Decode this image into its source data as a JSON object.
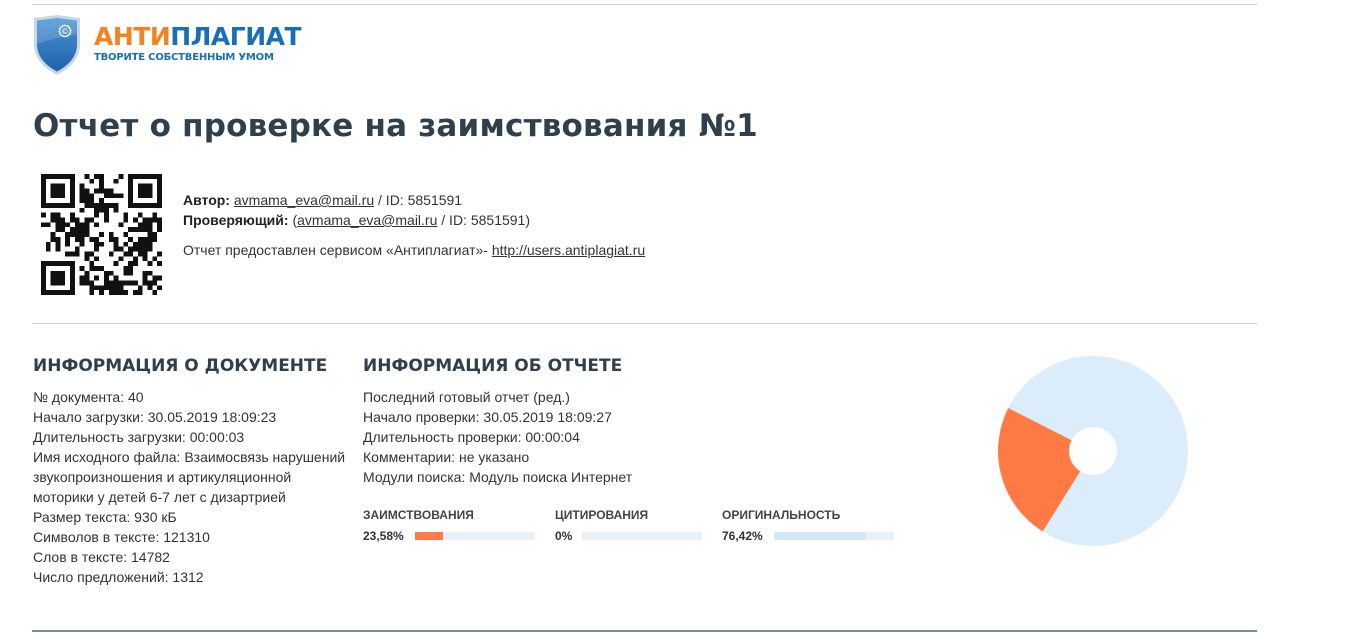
{
  "logo": {
    "name_part1": "АНТИ",
    "name_part2": "ПЛАГИАТ",
    "slogan": "ТВОРИТЕ СОБСТВЕННЫМ УМОМ",
    "shield_mark": "©"
  },
  "title": "Отчет о проверке на заимствования №1",
  "meta": {
    "author_label": "Автор:",
    "author_email": "avmama_eva@mail.ru",
    "author_id": " / ID: 5851591",
    "checker_label": "Проверяющий:",
    "checker_open": " (",
    "checker_email": "avmama_eva@mail.ru",
    "checker_id": " / ID: 5851591)",
    "provided_text": "Отчет предоставлен сервисом «Антиплагиат»- ",
    "provided_link": "http://users.antiplagiat.ru"
  },
  "doc_info": {
    "title": "ИНФОРМАЦИЯ О ДОКУМЕНТЕ",
    "lines": [
      "№ документа: 40",
      "Начало загрузки: 30.05.2019 18:09:23",
      "Длительность загрузки: 00:00:03",
      "Имя исходного файла: Взаимосвязь нарушений звукопроизношения и артикуляционной моторики у детей 6-7 лет с дизартрией",
      "Размер текста: 930 кБ",
      "Символов в тексте: 121310",
      "Слов в тексте: 14782",
      "Число предложений: 1312"
    ]
  },
  "report_info": {
    "title": "ИНФОРМАЦИЯ ОБ ОТЧЕТЕ",
    "lines": [
      "Последний готовый отчет (ред.)",
      "Начало проверки: 30.05.2019 18:09:27",
      "Длительность проверки: 00:00:04",
      "Комментарии: не указано",
      "Модули поиска: Модуль поиска Интернет"
    ]
  },
  "stats": [
    {
      "label": "ЗАИМСТВОВАНИЯ",
      "value": "23,58%",
      "fraction": 0.2358,
      "color": "#ff7a45"
    },
    {
      "label": "ЦИТИРОВАНИЯ",
      "value": "0%",
      "fraction": 0.0,
      "color": "#7cc36b"
    },
    {
      "label": "ОРИГИНАЛЬНОСТЬ",
      "value": "76,42%",
      "fraction": 0.7642,
      "color": "#d5e8f8"
    }
  ],
  "colors": {
    "borrowed": "#ff7a45",
    "original": "#dbecfa",
    "heading": "#2f3f4c",
    "brand_orange": "#f58220",
    "brand_blue": "#1a6eb5"
  }
}
